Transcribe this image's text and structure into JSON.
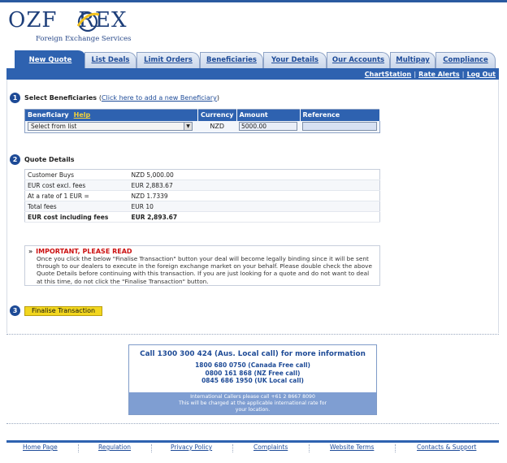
{
  "logo": {
    "wordmark_left": "OZF",
    "wordmark_right": "REX",
    "tagline": "Foreign Exchange Services"
  },
  "tabs": [
    {
      "label": "New Quote",
      "active": true
    },
    {
      "label": "List Deals",
      "active": false
    },
    {
      "label": "Limit Orders",
      "active": false
    },
    {
      "label": "Beneficiaries",
      "active": false
    },
    {
      "label": "Your Details",
      "active": false
    },
    {
      "label": "Our Accounts",
      "active": false
    },
    {
      "label": "Multipay",
      "active": false
    },
    {
      "label": "Compliance",
      "active": false
    }
  ],
  "subnav": {
    "chartstation": "ChartStation",
    "rate_alerts": "Rate Alerts",
    "log_out": "Log Out",
    "separator": "|"
  },
  "step1": {
    "number": "1",
    "title": "Select Beneficiaries",
    "link_open": "(",
    "link": "Click here to add a new Beneficiary",
    "link_close": ")"
  },
  "beneficiary_table": {
    "headers": {
      "beneficiary": "Beneficiary",
      "help": "Help",
      "currency": "Currency",
      "amount": "Amount",
      "reference": "Reference"
    },
    "row": {
      "select_value": "Select from list",
      "currency": "NZD",
      "amount": "5000.00",
      "reference": ""
    }
  },
  "step2": {
    "number": "2",
    "title": "Quote Details"
  },
  "quote": [
    {
      "label": "Customer Buys",
      "value": "NZD 5,000.00"
    },
    {
      "label": "EUR cost excl. fees",
      "value": "EUR 2,883.67"
    },
    {
      "label": "At a rate of 1 EUR =",
      "value": "NZD 1.7339"
    },
    {
      "label": "Total fees",
      "value": "EUR 10"
    },
    {
      "label": "EUR cost including fees",
      "value": "EUR 2,893.67"
    }
  ],
  "notice": {
    "arrow": "»",
    "title": "IMPORTANT, PLEASE READ",
    "body": "Once you click the below \"Finalise Transaction\" button your deal will become legally binding since it will be sent through to our dealers to execute in the foreign exchange market on your behalf. Please double check the above Quote Details before continuing with this transaction. If you are just looking for a quote and do not want to deal at this time, do not click the \"Finalise Transaction\" button."
  },
  "step3": {
    "number": "3",
    "button": "Finalise Transaction"
  },
  "contact": {
    "main": "Call 1300 300 424 (Aus. Local call) for more information",
    "lines": [
      "1800 680 0750 (Canada Free call)",
      "0800 161 868 (NZ Free call)",
      "0845 686 1950 (UK Local call)"
    ],
    "intl_1": "International Callers please call +61 2 8667 8090",
    "intl_2": "This will be charged at the applicable international rate for",
    "intl_3": "your location."
  },
  "footer": [
    "Home Page",
    "Regulation",
    "Privacy Policy",
    "Complaints",
    "Website Terms",
    "Contacts & Support"
  ],
  "colors": {
    "brand_blue": "#2e62b0",
    "logo_blue": "#1e3f7a",
    "help_yellow": "#f2d23a",
    "warning_red": "#cc1111",
    "button_yellow": "#f2d61e"
  }
}
